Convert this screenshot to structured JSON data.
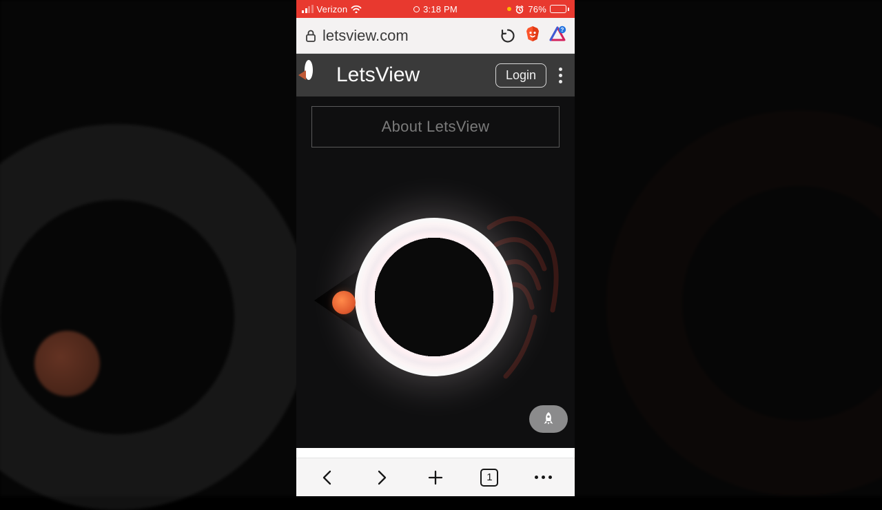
{
  "status": {
    "carrier": "Verizon",
    "time": "3:18 PM",
    "battery_pct": "76%"
  },
  "browser": {
    "url_display": "letsview.com",
    "tab_count": "1"
  },
  "site": {
    "title": "LetsView",
    "login_label": "Login",
    "about_label": "About LetsView"
  }
}
